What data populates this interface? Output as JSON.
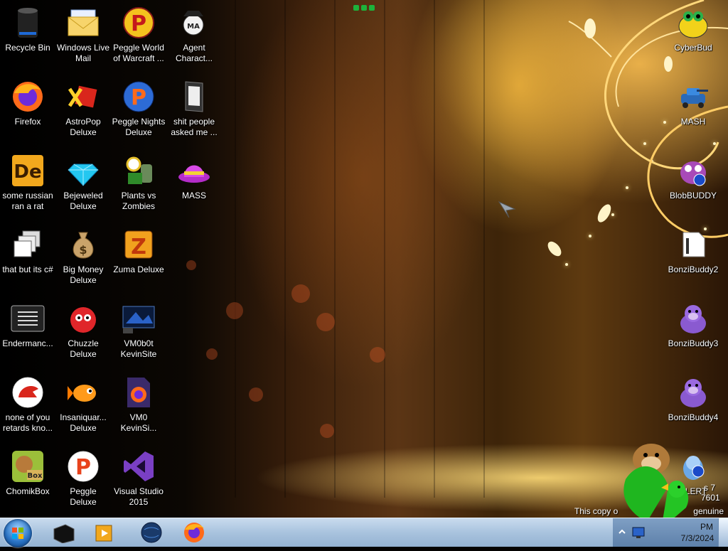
{
  "desktop_icons": [
    {
      "label": "Recycle Bin",
      "icon": "recycle-bin-icon"
    },
    {
      "label": "Windows Live Mail",
      "icon": "mail-icon"
    },
    {
      "label": "Peggle World of Warcraft ...",
      "icon": "peggle-icon"
    },
    {
      "label": "Agent Charact...",
      "icon": "agent-character-icon"
    },
    {
      "label": "Firefox",
      "icon": "firefox-icon"
    },
    {
      "label": "AstroPop Deluxe",
      "icon": "astropop-icon"
    },
    {
      "label": "Peggle Nights Deluxe",
      "icon": "peggle-nights-icon"
    },
    {
      "label": "shit people asked me ...",
      "icon": "folder-icon"
    },
    {
      "label": "some russian ran a rat",
      "icon": "de-app-icon"
    },
    {
      "label": "Bejeweled Deluxe",
      "icon": "gem-icon"
    },
    {
      "label": "Plants vs Zombies",
      "icon": "plants-vs-zombies-icon"
    },
    {
      "label": "MASS",
      "icon": "purple-hat-icon"
    },
    {
      "label": "that but its c#",
      "icon": "windows-stack-icon"
    },
    {
      "label": "Big Money Deluxe",
      "icon": "money-bag-icon"
    },
    {
      "label": "Zuma Deluxe",
      "icon": "zuma-icon"
    },
    {
      "label": "Endermanc...",
      "icon": "console-icon"
    },
    {
      "label": "Chuzzle Deluxe",
      "icon": "chuzzle-icon"
    },
    {
      "label": "VM0b0t KevinSite",
      "icon": "vm-icon"
    },
    {
      "label": "none of you retards kno...",
      "icon": "red-dino-icon"
    },
    {
      "label": "Insaniquar... Deluxe",
      "icon": "fish-icon"
    },
    {
      "label": "VM0 KevinSi...",
      "icon": "firefox-file-icon"
    },
    {
      "label": "ChomikBox",
      "icon": "chomikbox-icon"
    },
    {
      "label": "Peggle Deluxe",
      "icon": "peggle-deluxe-icon"
    },
    {
      "label": "Visual Studio 2015",
      "icon": "visual-studio-icon"
    },
    {
      "label": "CyberBud",
      "icon": "cyberbud-icon"
    },
    {
      "label": "MASH",
      "icon": "mash-icon"
    },
    {
      "label": "BlobBUDDY",
      "icon": "blobbuddy-icon"
    },
    {
      "label": "BonziBuddy2",
      "icon": "bonzi-file-icon"
    },
    {
      "label": "BonziBuddy3",
      "icon": "bonzi-gorilla-icon"
    },
    {
      "label": "BonziBuddy4",
      "icon": "bonzi-gorilla-icon"
    },
    {
      "label": "ALERT",
      "icon": "alert-icon"
    }
  ],
  "watermark": {
    "line1": "s 7",
    "line2": "7601",
    "line3": "This copy o",
    "line4": "genuine"
  },
  "taskbar": {
    "pinned": [
      "file-explorer",
      "media-player",
      "globe-app",
      "firefox"
    ],
    "clock_time": "PM",
    "clock_date": "7/3/2024"
  },
  "colors": {
    "taskbar": "#a9c3de",
    "label_text": "#ffffff"
  }
}
